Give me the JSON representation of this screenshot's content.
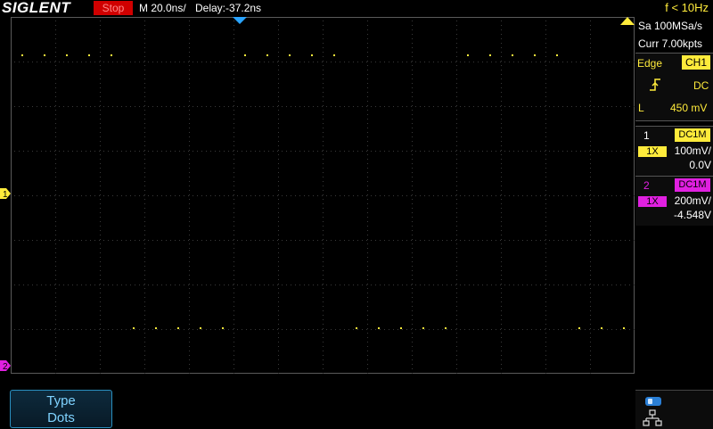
{
  "header": {
    "logo": "SIGLENT",
    "run_status": "Stop",
    "timebase": "M 20.0ns/",
    "delay": "Delay:-37.2ns",
    "frequency": "f < 10Hz"
  },
  "acquisition": {
    "sample_rate": "Sa 100MSa/s",
    "memory_depth": "Curr 7.00kpts"
  },
  "trigger": {
    "type": "Edge",
    "source": "CH1",
    "coupling": "DC",
    "level_label": "L",
    "level_value": "450 mV"
  },
  "channels": [
    {
      "number": "1",
      "coupling": "DC1M",
      "probe": "1X",
      "scale": "100mV/",
      "offset": "0.0V",
      "color": "#ffeb3b"
    },
    {
      "number": "2",
      "coupling": "DC1M",
      "probe": "1X",
      "scale": "200mV/",
      "offset": "-4.548V",
      "color": "#e020e0"
    }
  ],
  "markers": {
    "ch1": "1",
    "ch2": "2"
  },
  "softkey": {
    "title": "Type",
    "value": "Dots"
  },
  "waveform": {
    "color": "#ffeb3b",
    "high_level_fraction": 0.105,
    "low_level_fraction": 0.87,
    "period_divs": 5,
    "duty_high": 0.5
  }
}
